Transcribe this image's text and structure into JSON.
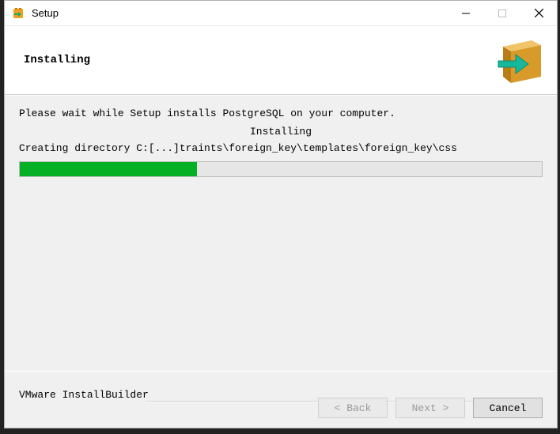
{
  "window": {
    "title": "Setup",
    "controls": {
      "minimize": "true",
      "maximize": "false",
      "close": "true"
    }
  },
  "header": {
    "title": "Installing"
  },
  "body": {
    "wait_text": "Please wait while Setup installs PostgreSQL on your computer.",
    "status_center": "Installing",
    "path_line": "Creating directory C:[...]traints\\foreign_key\\templates\\foreign_key\\css",
    "progress_percent": 34
  },
  "footer": {
    "brand": "VMware InstallBuilder",
    "back_label": "< Back",
    "next_label": "Next >",
    "cancel_label": "Cancel",
    "back_enabled": false,
    "next_enabled": false,
    "cancel_enabled": true
  }
}
